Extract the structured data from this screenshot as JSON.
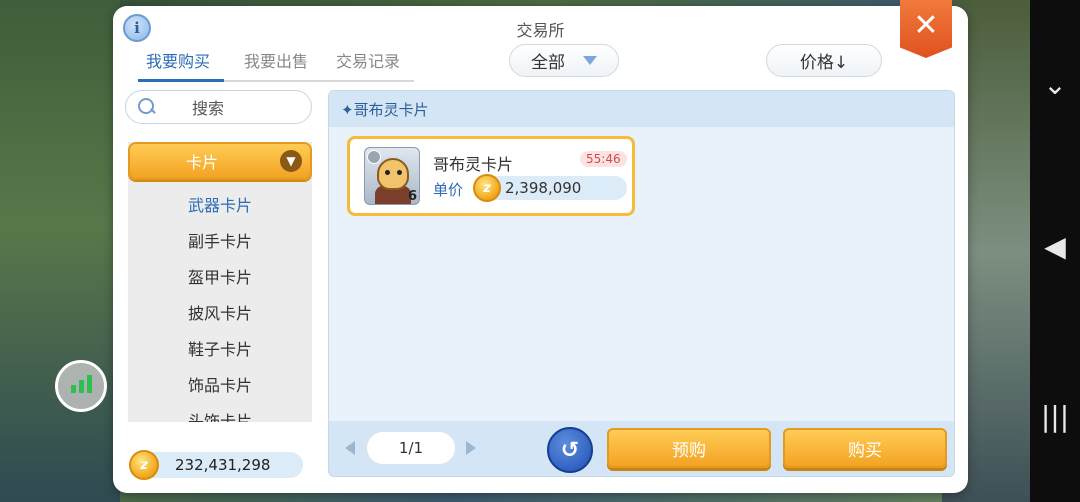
{
  "window": {
    "title": "交易所",
    "close_label": "✕",
    "info_label": "i"
  },
  "tabs": [
    {
      "label": "我要购买",
      "active": true
    },
    {
      "label": "我要出售",
      "active": false
    },
    {
      "label": "交易记录",
      "active": false
    }
  ],
  "filter": {
    "value": "全部"
  },
  "sort": {
    "label": "价格↓"
  },
  "search": {
    "label": "搜索"
  },
  "categories": {
    "header": "卡片",
    "items": [
      "武器卡片",
      "副手卡片",
      "盔甲卡片",
      "披风卡片",
      "鞋子卡片",
      "饰品卡片",
      "头饰卡片"
    ],
    "selected": "武器卡片"
  },
  "balance": {
    "value": "232,431,298",
    "coin_icon": "zeny-coin-icon"
  },
  "content": {
    "heading": "✦哥布灵卡片",
    "listing": {
      "name": "哥布灵卡片",
      "timer": "55:46",
      "price_label": "单价",
      "price": "2,398,090",
      "level": "6"
    }
  },
  "pagination": {
    "page": "1/1"
  },
  "buttons": {
    "preorder": "预购",
    "buy": "购买",
    "refresh_symbol": "↺"
  },
  "colors": {
    "accent": "#2d6cb6",
    "button_gold": "#f3a323",
    "close_orange": "#e0521f",
    "timer_red": "#d24b4b"
  }
}
